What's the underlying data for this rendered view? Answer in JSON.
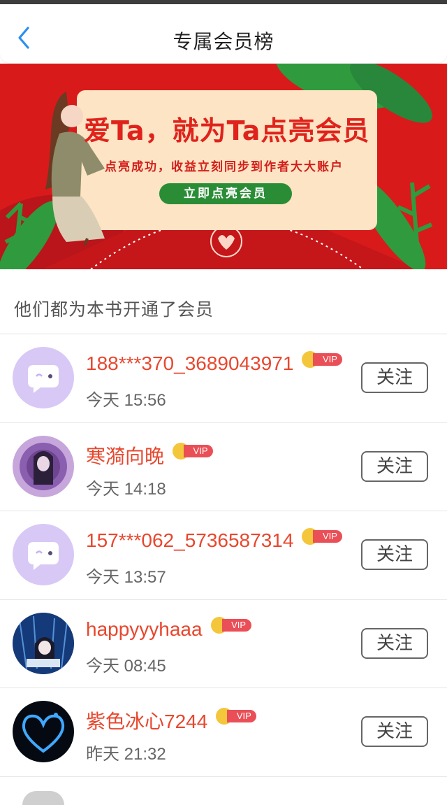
{
  "header": {
    "title": "专属会员榜"
  },
  "banner": {
    "headline": "爱Ta，就为Ta点亮会员",
    "subtitle": "点亮成功，收益立刻同步到作者大大账户",
    "button": "立即点亮会员"
  },
  "section": {
    "title": "他们都为本书开通了会员"
  },
  "members": [
    {
      "name": "188***370_3689043971",
      "time": "今天 15:56",
      "badge": "VIP",
      "follow": "关注",
      "avatar": "default-chat-avatar"
    },
    {
      "name": "寒漪向晚",
      "time": "今天 14:18",
      "badge": "VIP",
      "follow": "关注",
      "avatar": "anime-girl-purple-avatar"
    },
    {
      "name": "157***062_5736587314",
      "time": "今天 13:57",
      "badge": "VIP",
      "follow": "关注",
      "avatar": "default-chat-avatar"
    },
    {
      "name": "happyyyhaaa",
      "time": "今天 08:45",
      "badge": "VIP",
      "follow": "关注",
      "avatar": "anime-character-blue-avatar"
    },
    {
      "name": "紫色冰心7244",
      "time": "昨天 21:32",
      "badge": "VIP",
      "follow": "关注",
      "avatar": "blue-heart-avatar"
    }
  ],
  "colors": {
    "name": "#e8472e",
    "banner_bg": "#d91a1a",
    "vip_tag": "#ea4f57",
    "crown": "#f4c63b",
    "back": "#2b8ff0"
  }
}
